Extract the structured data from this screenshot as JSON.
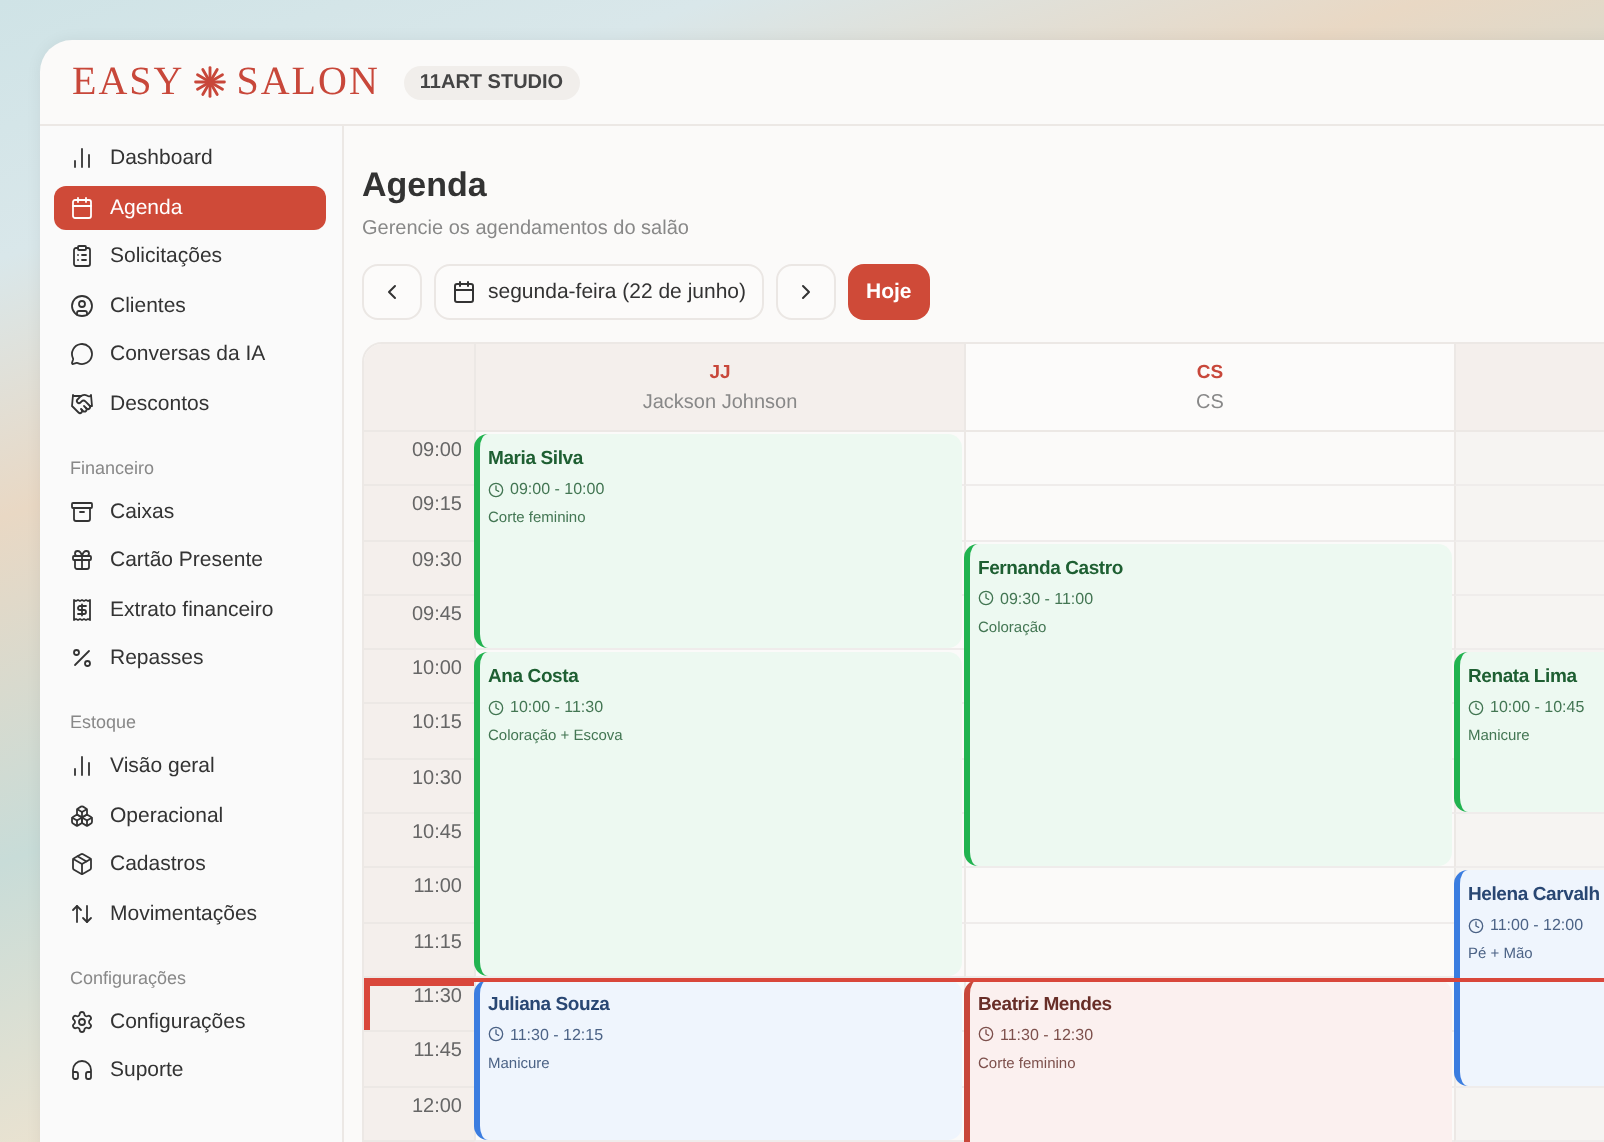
{
  "brand": {
    "logo_left": "EASY",
    "logo_right": "SALON",
    "studio": "11ART STUDIO"
  },
  "sidebar": {
    "sections": [
      {
        "items": [
          {
            "label": "Dashboard",
            "selected": false
          },
          {
            "label": "Agenda",
            "selected": true
          },
          {
            "label": "Solicitações",
            "selected": false
          },
          {
            "label": "Clientes",
            "selected": false
          },
          {
            "label": "Conversas da IA",
            "selected": false
          },
          {
            "label": "Descontos",
            "selected": false
          }
        ]
      },
      {
        "heading": "Financeiro",
        "items": [
          {
            "label": "Caixas",
            "selected": false
          },
          {
            "label": "Cartão Presente",
            "selected": false
          },
          {
            "label": "Extrato financeiro",
            "selected": false
          },
          {
            "label": "Repasses",
            "selected": false
          }
        ]
      },
      {
        "heading": "Estoque",
        "items": [
          {
            "label": "Visão geral",
            "selected": false
          },
          {
            "label": "Operacional",
            "selected": false
          },
          {
            "label": "Cadastros",
            "selected": false
          },
          {
            "label": "Movimentações",
            "selected": false
          }
        ]
      },
      {
        "heading": "Configurações",
        "items": [
          {
            "label": "Configurações",
            "selected": false
          },
          {
            "label": "Suporte",
            "selected": false
          }
        ]
      }
    ]
  },
  "page": {
    "title": "Agenda",
    "subtitle": "Gerencie os agendamentos do salão"
  },
  "date_nav": {
    "date": "segunda-feira (22 de junho)",
    "today_button": "Hoje"
  },
  "calendar": {
    "time_slots": [
      {
        "label": "09:00",
        "current": false
      },
      {
        "label": "09:15",
        "current": false
      },
      {
        "label": "09:30",
        "current": false
      },
      {
        "label": "09:45",
        "current": false
      },
      {
        "label": "10:00",
        "current": false
      },
      {
        "label": "10:15",
        "current": false
      },
      {
        "label": "10:30",
        "current": false
      },
      {
        "label": "10:45",
        "current": false
      },
      {
        "label": "11:00",
        "current": false
      },
      {
        "label": "11:15",
        "current": false
      },
      {
        "label": "11:30",
        "current": true
      },
      {
        "label": "11:45",
        "current": false
      },
      {
        "label": "12:00",
        "current": false
      }
    ],
    "columns": [
      {
        "initials": "JJ",
        "name": "Jackson Johnson",
        "appointments": [
          {
            "client": "Maria Silva",
            "time": "09:00 - 10:00",
            "service": "Corte feminino",
            "color": "#22b350"
          },
          {
            "client": "Ana Costa",
            "time": "10:00 - 11:30",
            "service": "Coloração + Escova",
            "color": "#22b350"
          },
          {
            "client": "Juliana Souza",
            "time": "11:30 - 12:15",
            "service": "Manicure",
            "color": "#3b7de0"
          }
        ]
      },
      {
        "initials": "CS",
        "name": "CS",
        "appointments": [
          {
            "client": "Fernanda Castro",
            "time": "09:30 - 11:00",
            "service": "Coloração",
            "color": "#22b350"
          },
          {
            "client": "Beatriz Mendes",
            "time": "11:30 - 12:30",
            "service": "Corte feminino",
            "color": "#c8473a"
          }
        ]
      },
      {
        "appointments": [
          {
            "client": "Renata Lima",
            "time": "10:00 - 10:45",
            "service": "Manicure",
            "color": "#22b350"
          },
          {
            "client": "Helena Carvalh",
            "time": "11:00 - 12:00",
            "service": "Pé + Mão",
            "color": "#3b7de0"
          }
        ]
      }
    ]
  }
}
